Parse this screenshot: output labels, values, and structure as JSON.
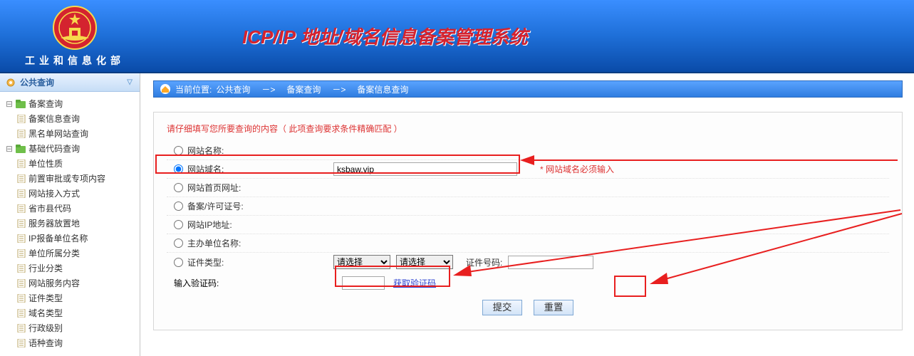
{
  "header": {
    "org_label": "工业和信息化部",
    "system_title": "ICP/IP 地址/域名信息备案管理系统"
  },
  "sidebar": {
    "panel_title": "公共查询",
    "groups": [
      {
        "label": "备案查询",
        "children": [
          "备案信息查询",
          "黑名单网站查询"
        ]
      },
      {
        "label": "基础代码查询",
        "children": [
          "单位性质",
          "前置审批或专项内容",
          "网站接入方式",
          "省市县代码",
          "服务器放置地",
          "IP报备单位名称",
          "单位所属分类",
          "行业分类",
          "网站服务内容",
          "证件类型",
          "域名类型",
          "行政级别",
          "语种查询"
        ]
      }
    ]
  },
  "breadcrumb": {
    "prefix": "当前位置:",
    "path1": "公共查询",
    "arrow": "－>",
    "path2": "备案查询",
    "path3": "备案信息查询"
  },
  "form": {
    "tip": "请仔细填写您所要查询的内容（ 此项查询要求条件精确匹配 ）",
    "rows": [
      {
        "label": "网站名称:"
      },
      {
        "label": "网站域名:",
        "value": "ksbaw.vip",
        "hint": "* 网站域名必须输入"
      },
      {
        "label": "网站首页网址:"
      },
      {
        "label": "备案/许可证号:"
      },
      {
        "label": "网站IP地址:"
      },
      {
        "label": "主办单位名称:"
      },
      {
        "label": "证件类型:"
      }
    ],
    "select_placeholder": "请选择",
    "cert_no_label": "证件号码:",
    "captcha_label": "输入验证码:",
    "captcha_link": "获取验证码",
    "submit": "提交",
    "reset": "重置"
  }
}
